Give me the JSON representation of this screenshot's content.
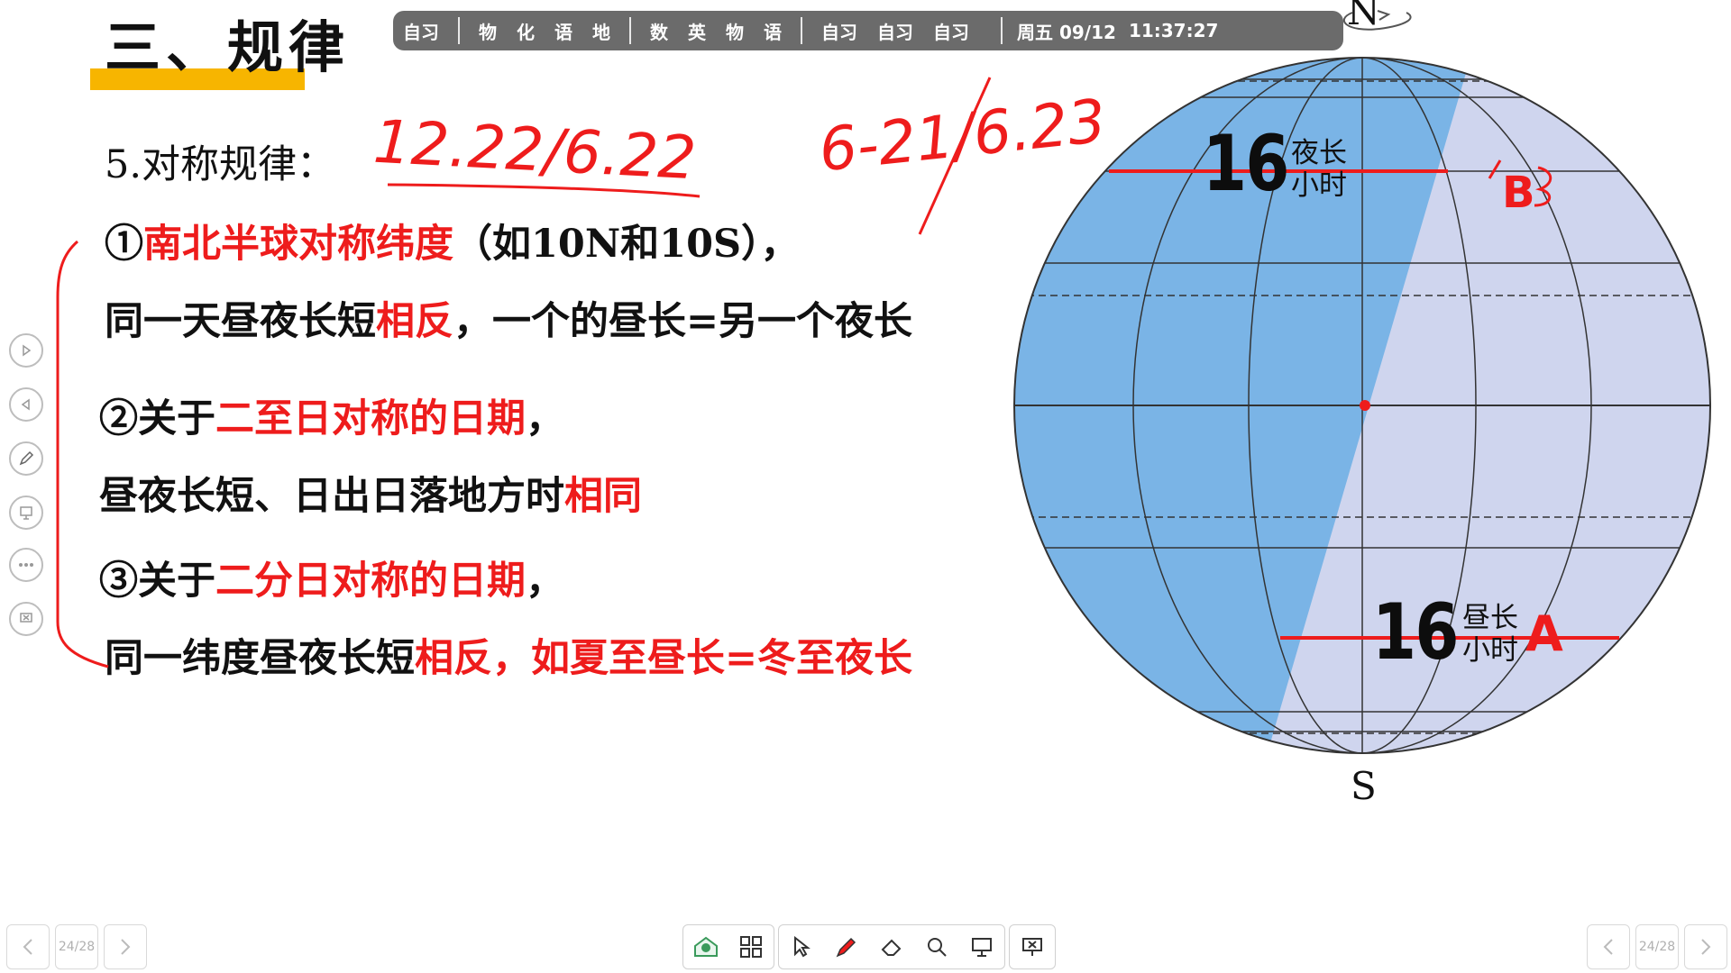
{
  "title": "三、规律",
  "schedule": {
    "items": [
      [
        "自习"
      ],
      [
        "物",
        "化",
        "语",
        "地"
      ],
      [
        "数",
        "英",
        "物",
        "语"
      ],
      [
        "自习",
        "自习",
        "自习"
      ]
    ],
    "date": "周五 09/12",
    "time": "11:37:27"
  },
  "content": {
    "heading": "5.对称规律：",
    "rule1_prefix": "①",
    "rule1_red": "南北半球对称纬度",
    "rule1_suffix": "（如10N和10S），",
    "rule1_l2_a": "同一天昼夜长短",
    "rule1_l2_red": "相反",
    "rule1_l2_b": "，一个的昼长=另一个夜长",
    "rule2_prefix": "②关于",
    "rule2_red": "二至日对称的日期",
    "rule2_suffix": "，",
    "rule2_l2_a": "昼夜长短、日出日落地方时",
    "rule2_l2_red": "相同",
    "rule3_prefix": "③关于",
    "rule3_red": "二分日对称的日期",
    "rule3_suffix": "，",
    "rule3_l2_a": "同一纬度昼夜长短",
    "rule3_l2_red": "相反，如夏至昼长=冬至夜长"
  },
  "annotations": {
    "date_pair_1": "12.22/6.22",
    "date_pair_2": "6-21/6.23",
    "mark_b": "B",
    "mark_a": "A"
  },
  "globe": {
    "north": "N",
    "south": "S",
    "upper_value": "16",
    "upper_label_1": "夜长",
    "upper_label_2": "小时",
    "lower_value": "16",
    "lower_label_1": "昼长",
    "lower_label_2": "小时",
    "colors": {
      "night": "#7ab4e6",
      "day": "#cfd5ee",
      "mark": "#ee1c1c"
    }
  },
  "navigation": {
    "page_left": "24/28",
    "page_right": "24/28"
  },
  "side_toolbar": [
    "play-icon",
    "back-icon",
    "pen-icon",
    "screen-icon",
    "more-icon",
    "close-screen-icon"
  ],
  "bottom_toolbar": [
    "whiteboard-icon",
    "grid-icon",
    "pointer-icon",
    "pen-icon",
    "eraser-icon",
    "search-icon",
    "projector-icon",
    "exit-icon"
  ]
}
